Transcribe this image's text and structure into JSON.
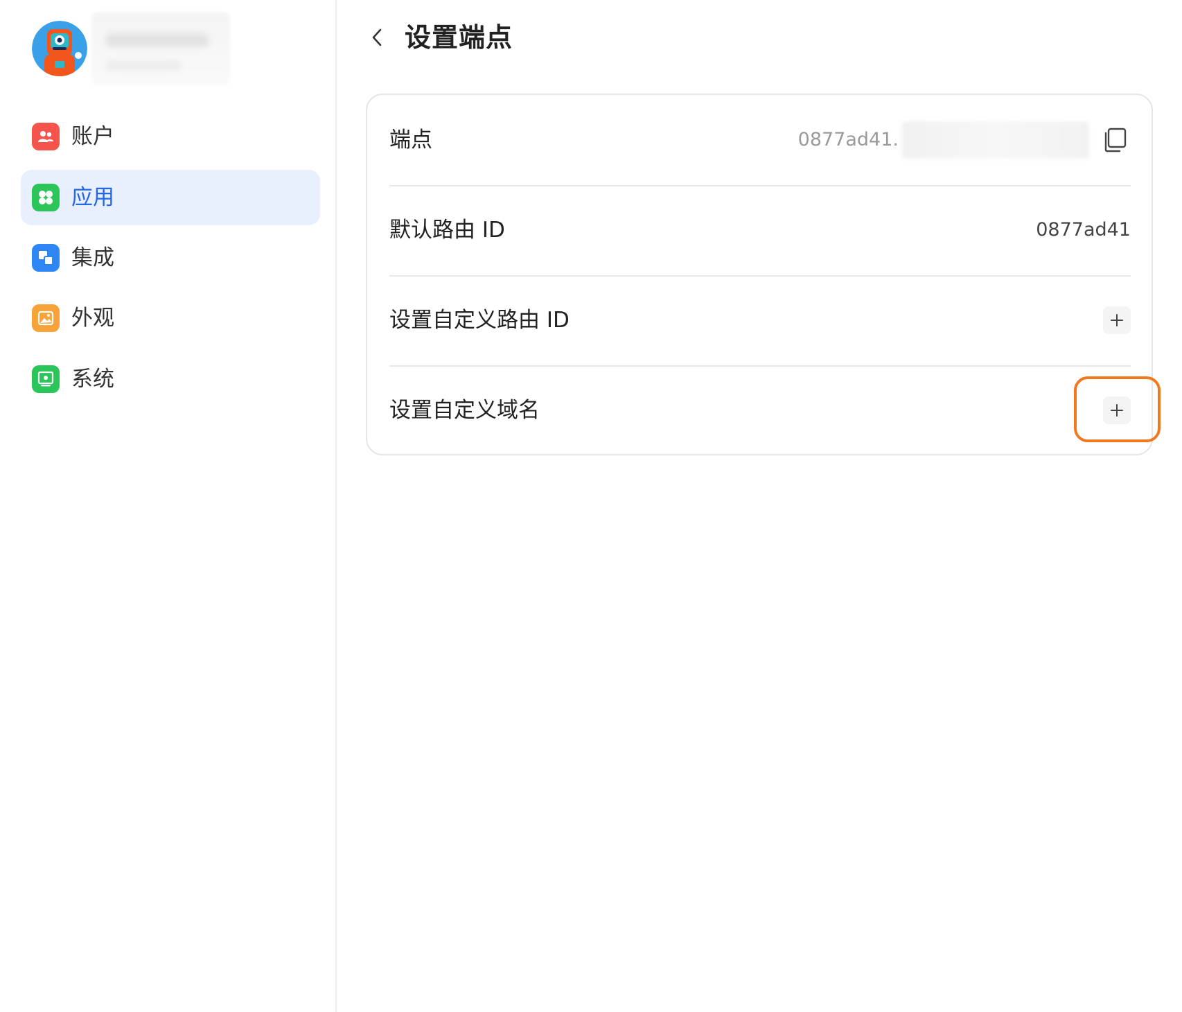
{
  "sidebar": {
    "items": [
      {
        "id": "account",
        "label": "账户",
        "icon": "users-icon",
        "color": "#f4544b"
      },
      {
        "id": "apps",
        "label": "应用",
        "icon": "apps-grid-icon",
        "color": "#2cc55a",
        "active": true
      },
      {
        "id": "integrations",
        "label": "集成",
        "icon": "integration-icon",
        "color": "#2e86f5"
      },
      {
        "id": "appearance",
        "label": "外观",
        "icon": "image-icon",
        "color": "#f7a33a"
      },
      {
        "id": "system",
        "label": "系统",
        "icon": "system-icon",
        "color": "#2cc55a"
      }
    ]
  },
  "header": {
    "title": "设置端点"
  },
  "settings": {
    "endpoint": {
      "label": "端点",
      "value": "0877ad41."
    },
    "default_route": {
      "label": "默认路由 ID",
      "value": "0877ad41"
    },
    "custom_route": {
      "label": "设置自定义路由 ID"
    },
    "custom_domain": {
      "label": "设置自定义域名"
    }
  },
  "colors": {
    "accent": "#2466e8",
    "active_nav_bg": "#e8effd",
    "highlight": "#f07820"
  }
}
